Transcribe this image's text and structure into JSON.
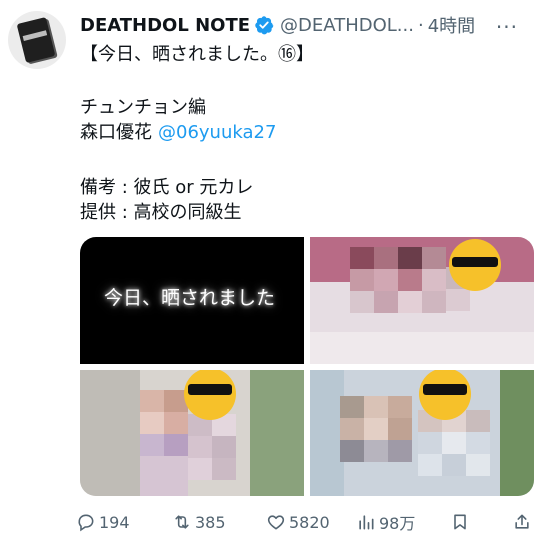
{
  "tweet": {
    "display_name": "DEATHDOL NOTE",
    "handle": "@DEATHDOL...",
    "separator": "·",
    "time": "4時間",
    "more": "···",
    "lines": {
      "l1": "【今日、晒されました。⑯】",
      "l2": "チュンチョン編",
      "l3_name": "森口優花",
      "l3_mention": "@06yuuka27",
      "l4": "備考 : 彼氏 or 元カレ",
      "l5": "提供 : 高校の同級生"
    },
    "media": {
      "image1_text": "今日、晒されました"
    }
  },
  "actions": {
    "replies": "194",
    "retweets": "385",
    "likes": "5820",
    "views": "98万"
  },
  "colors": {
    "accent": "#1d9bf0",
    "secondary_text": "#536471",
    "primary_text": "#0f1419"
  }
}
